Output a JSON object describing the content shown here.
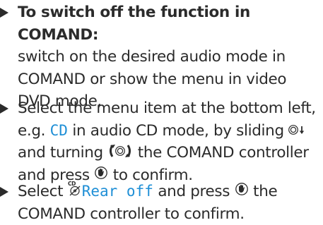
{
  "steps": [
    {
      "heading": "To switch off the function in COMAND:",
      "text": "switch on the desired audio mode in COMAND or show the menu in video DVD mode."
    },
    {
      "text_before": "Select the menu item at the bottom left, e.g.",
      "highlight": "CD",
      "text_after_highlight": "in audio CD mode, by sliding",
      "text_turning": "and turning",
      "text_controller": "the COMAND controller and press",
      "text_end": "to confirm."
    },
    {
      "text_before": "Select",
      "highlight": "Rear off",
      "text_press": "and press",
      "text_end": "the COMAND controller to confirm."
    }
  ],
  "icons": {
    "bullet": "triangle-bullet-icon",
    "controller_slide": "controller-slide-down-icon",
    "controller_turn": "controller-turn-icon",
    "controller_press": "controller-press-icon",
    "rear_cd": "rear-cd-icon"
  },
  "colors": {
    "text": "#2b2b2b",
    "highlight": "#1f8fd6"
  }
}
